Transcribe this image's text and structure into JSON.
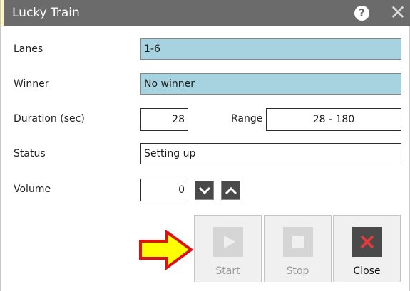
{
  "window": {
    "title": "Lucky Train",
    "help_glyph": "?",
    "close_glyph": "✕"
  },
  "form": {
    "lanes_label": "Lanes",
    "lanes_value": "1-6",
    "winner_label": "Winner",
    "winner_value": "No winner",
    "duration_label": "Duration (sec)",
    "duration_value": "28",
    "range_label": "Range",
    "range_value": "28 - 180",
    "status_label": "Status",
    "status_value": "Setting up",
    "volume_label": "Volume",
    "volume_value": "0"
  },
  "buttons": {
    "start_label": "Start",
    "stop_label": "Stop",
    "close_label": "Close"
  },
  "icons": {
    "help": "question-circle-icon",
    "close": "close-x-icon",
    "down": "chevron-down-icon",
    "up": "chevron-up-icon",
    "play": "play-icon",
    "stop": "stop-square-icon",
    "close_action": "red-x-icon",
    "pointer": "yellow-arrow-icon"
  },
  "colors": {
    "titlebar": "#6b6b6b",
    "field_highlight": "#a7d3e1",
    "close_accent": "#e23b3b",
    "arrow_fill": "#ffff00",
    "arrow_stroke": "#e01010"
  }
}
